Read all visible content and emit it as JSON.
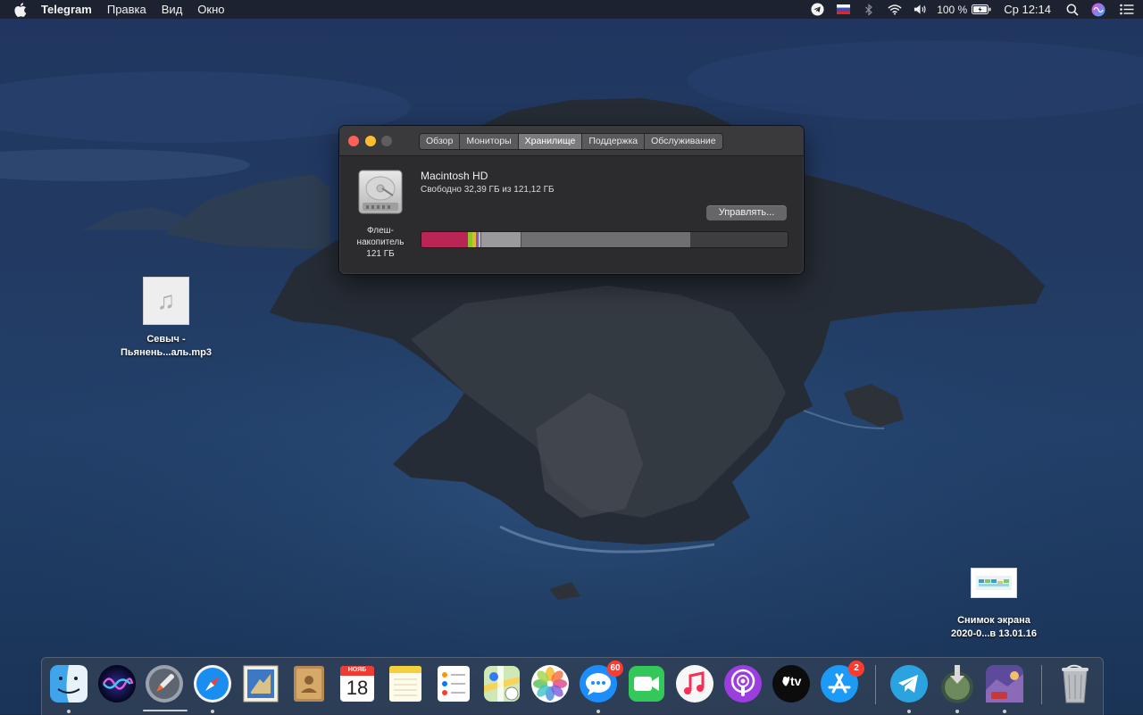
{
  "menubar": {
    "app_name": "Telegram",
    "menus": [
      "Правка",
      "Вид",
      "Окно"
    ],
    "battery_text": "100 %",
    "clock": "Ср 12:14"
  },
  "window": {
    "tabs": [
      "Обзор",
      "Мониторы",
      "Хранилище",
      "Поддержка",
      "Обслуживание"
    ],
    "active_tab": "Хранилище",
    "disk": {
      "caption_line1": "Флеш-",
      "caption_line2": "накопитель",
      "caption_line3": "121 ГБ"
    },
    "volume": {
      "name": "Macintosh HD",
      "free_text": "Свободно 32,39 ГБ из 121,12 ГБ"
    },
    "manage_button": "Управлять..."
  },
  "desktop": {
    "file_music": {
      "line1": "Севыч -",
      "line2": "Пьянень...аль.mp3"
    },
    "file_screenshot": {
      "line1": "Снимок экрана",
      "line2": "2020-0...в 13.01.16"
    }
  },
  "dock": {
    "calendar_month": "НОЯБ",
    "calendar_day": "18",
    "messages_badge": "60",
    "appstore_badge": "2",
    "appletv_label": "tv"
  }
}
